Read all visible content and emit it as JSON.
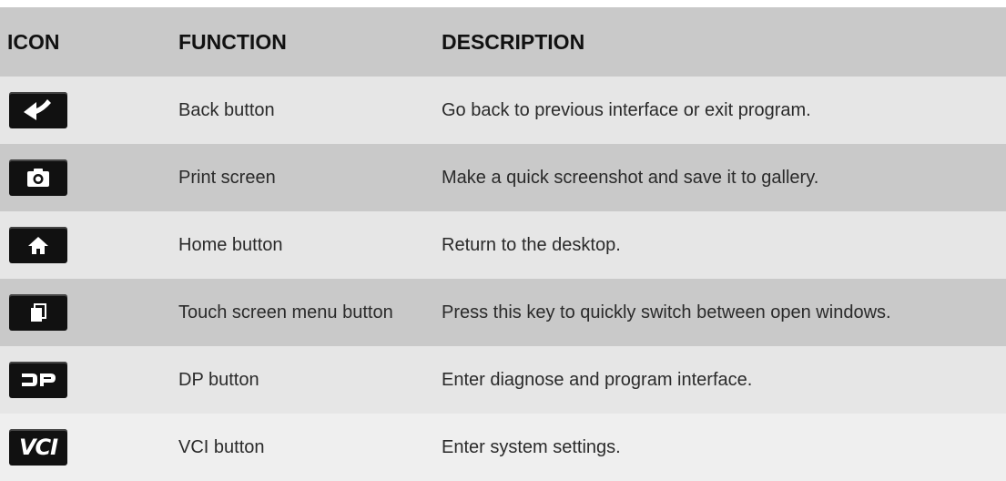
{
  "header": {
    "icon": "ICON",
    "function": "FUNCTION",
    "description": "DESCRIPTION"
  },
  "rows": [
    {
      "icon": "back-arrow-icon",
      "function": "Back button",
      "description": "Go back to previous interface or exit program."
    },
    {
      "icon": "camera-icon",
      "function": "Print screen",
      "description": "Make a quick screenshot and save it to gallery."
    },
    {
      "icon": "home-icon",
      "function": "Home button",
      "description": "Return to the desktop."
    },
    {
      "icon": "window-stack-icon",
      "function": "Touch screen menu button",
      "description": "Press this key to quickly switch between open windows."
    },
    {
      "icon": "dp-logo-icon",
      "function": "DP button",
      "description": "Enter diagnose and program interface."
    },
    {
      "icon": "vci-logo-icon",
      "icon_text": "VCI",
      "function": "VCI button",
      "description": "Enter system settings."
    }
  ]
}
